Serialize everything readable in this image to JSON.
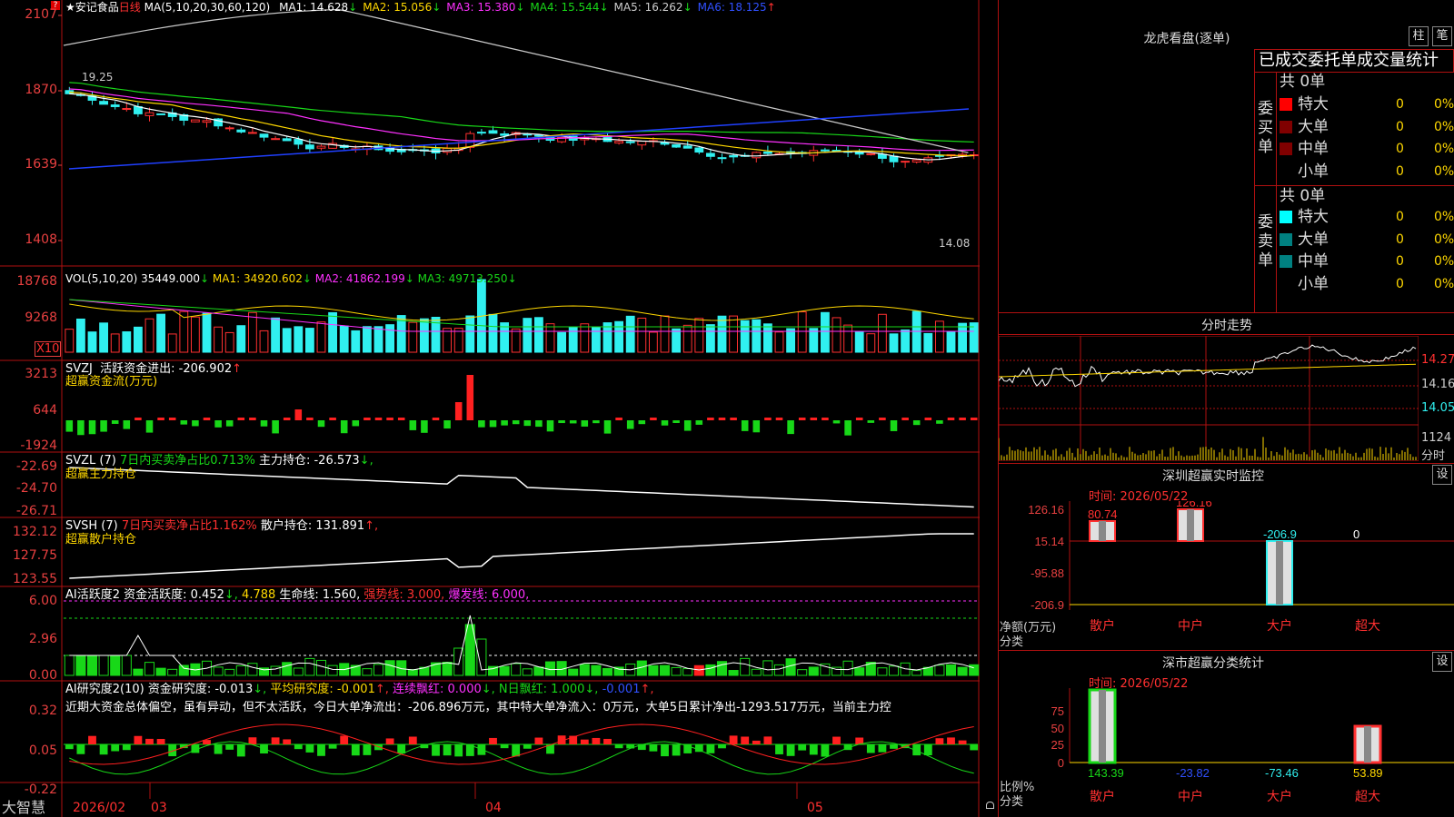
{
  "stock": {
    "star": "★",
    "name": "安记食品",
    "period": "日线"
  },
  "main_chart": {
    "ma_header": "MA(5,10,20,30,60,120)",
    "ma": [
      {
        "label": "MA1:",
        "value": "14.628",
        "arrow": "↓",
        "color": "#ffffff"
      },
      {
        "label": "MA2:",
        "value": "15.056",
        "arrow": "↓",
        "color": "#ffd800"
      },
      {
        "label": "MA3:",
        "value": "15.380",
        "arrow": "↓",
        "color": "#ff30ff"
      },
      {
        "label": "MA4:",
        "value": "15.544",
        "arrow": "↓",
        "color": "#18d818"
      },
      {
        "label": "MA5:",
        "value": "16.262",
        "arrow": "↓",
        "color": "#cccccc"
      },
      {
        "label": "MA6:",
        "value": "18.125",
        "arrow": "↑",
        "color": "#3050ff"
      }
    ],
    "axis": [
      "2107",
      "1870",
      "1639",
      "1408"
    ],
    "high_label": "19.25",
    "low_label": "14.08",
    "indicator_square": "?"
  },
  "vol_chart": {
    "title": "VOL(5,10,20)",
    "value": "35449.000",
    "arrow1": "↓",
    "ma1": "MA1: 34920.602",
    "a1": "↓",
    "ma2": "MA2: 41862.199",
    "a2": "↓",
    "ma3": "MA3: 49713.250",
    "a3": "↓",
    "axis": [
      "18768",
      "9268"
    ],
    "unit": "X10"
  },
  "svzj": {
    "title": "SVZJ",
    "text": "活跃资金进出: -206.902",
    "arrow": "↑",
    "sub": "超赢资金流(万元)",
    "axis": [
      "3213",
      "644",
      "-1924"
    ]
  },
  "svzl": {
    "title": "SVZL (7)",
    "pct": "7日内买卖净占比0.713%",
    "hold": "主力持仓: -26.573",
    "arrow": "↓,",
    "sub": "超赢主力持仓",
    "axis": [
      "-22.69",
      "-24.70",
      "-26.71"
    ]
  },
  "svsh": {
    "title": "SVSH (7)",
    "pct": "7日内买卖净占比1.162%",
    "hold": "散户持仓: 131.891",
    "arrow": "↑,",
    "sub": "超赢散户持仓",
    "axis": [
      "132.12",
      "127.75",
      "123.55"
    ]
  },
  "ai_active": {
    "title": "AI活跃度2",
    "t1": "资金活跃度: 0.452",
    "a1": "↓,",
    "t2": "4.788",
    "t3": "生命线: 1.560,",
    "t4": "强势线: 3.000,",
    "t5": "爆发线: 6.000,",
    "axis": [
      "6.00",
      "2.96",
      "0.00"
    ]
  },
  "ai_research": {
    "title": "AI研究度2(10)",
    "t1": "资金研究度: -0.013",
    "a1": "↓,",
    "t2": "平均研究度: -0.001",
    "a2": "↑,",
    "t3": "连续飘红: 0.000",
    "a3": "↓,",
    "t4": "N日飘红: 1.000",
    "a4": "↓,",
    "t5": "-0.001",
    "a5": "↑,",
    "comment": "近期大资金总体偏空，虽有异动，但不太活跃，今日大单净流出：-206.896万元，其中特大单净流入：0万元，大单5日累计净出-1293.517万元，当前主力控",
    "axis": [
      "0.32",
      "0.05",
      "-0.22"
    ]
  },
  "bottom_bar": {
    "brand": "大智慧",
    "dates": [
      "2026/02",
      "03",
      "04",
      "05"
    ]
  },
  "longhu": {
    "title": "龙虎看盘(逐单)",
    "btn1": "柱",
    "btn2": "笔",
    "tabs": "已成交委托单成交量统计",
    "buy": {
      "side": "委买单",
      "total": "共 0单",
      "rows": [
        {
          "label": "特大",
          "count": "0",
          "pct": "0%",
          "color": "#ff0000"
        },
        {
          "label": "大单",
          "count": "0",
          "pct": "0%",
          "color": "#800000"
        },
        {
          "label": "中单",
          "count": "0",
          "pct": "0%",
          "color": "#800000"
        },
        {
          "label": "小单",
          "count": "0",
          "pct": "0%",
          "color": "#000000"
        }
      ]
    },
    "sell": {
      "side": "委卖单",
      "total": "共 0单",
      "rows": [
        {
          "label": "特大",
          "count": "0",
          "pct": "0%",
          "color": "#00ffff"
        },
        {
          "label": "大单",
          "count": "0",
          "pct": "0%",
          "color": "#008080"
        },
        {
          "label": "中单",
          "count": "0",
          "pct": "0%",
          "color": "#008080"
        },
        {
          "label": "小单",
          "count": "0",
          "pct": "0%",
          "color": "#000000"
        }
      ]
    }
  },
  "intraday": {
    "title": "分时走势",
    "axis": [
      "14.27",
      "14.16",
      "14.05",
      "1124"
    ],
    "unit": "分时"
  },
  "sz_monitor": {
    "title": "深圳超赢实时监控",
    "btn": "设",
    "time": "时间: 2026/05/22",
    "axis": [
      "126.16",
      "15.14",
      "-95.88",
      "-206.9"
    ],
    "ylabel": "净额(万元)",
    "xlabel": "分类",
    "bars": [
      {
        "label": "散户",
        "value": "80.74"
      },
      {
        "label": "中户",
        "value": "126.16"
      },
      {
        "label": "大户",
        "value": "-206.9"
      },
      {
        "label": "超大",
        "value": "0"
      }
    ]
  },
  "sz_class": {
    "title": "深市超赢分类统计",
    "btn": "设",
    "time": "时间: 2026/05/22",
    "axis": [
      "75",
      "50",
      "25",
      "0"
    ],
    "ylabel": "比例%",
    "xlabel": "分类",
    "bars": [
      {
        "label": "散户",
        "value": "143.39",
        "color": "#18d818"
      },
      {
        "label": "中户",
        "value": "-23.82",
        "color": "#3050ff"
      },
      {
        "label": "大户",
        "value": "-73.46",
        "color": "#30f0f0"
      },
      {
        "label": "超大",
        "value": "53.89",
        "color": "#ffd800"
      }
    ]
  }
}
